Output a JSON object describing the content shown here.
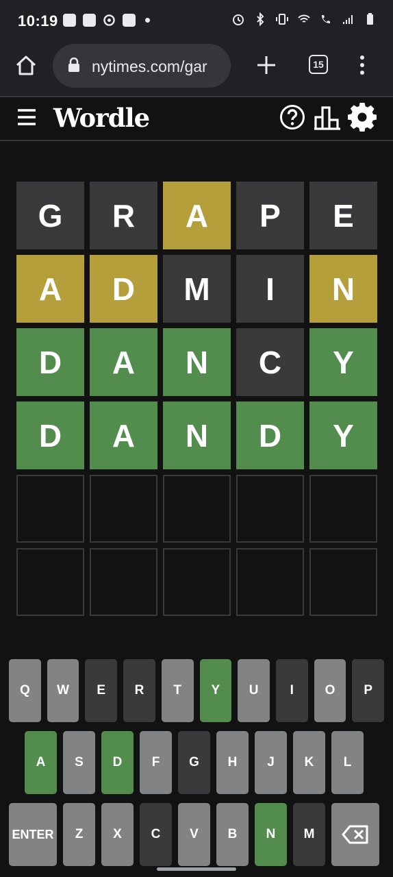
{
  "status_bar": {
    "time": "10:19",
    "left_icons": [
      "notification-icon",
      "news-icon",
      "swirl-icon",
      "news-icon",
      "dot-icon"
    ],
    "right_icons": [
      "alarm-icon",
      "bluetooth-icon",
      "vibrate-icon",
      "wifi-icon",
      "wifi-call-icon",
      "signal-icon",
      "battery-icon"
    ]
  },
  "browser": {
    "url": "nytimes.com/gar",
    "tab_count": "15"
  },
  "header": {
    "title": "Wordle"
  },
  "colors": {
    "correct": "#538d4e",
    "present": "#b59f3b",
    "absent": "#3a3a3c",
    "unused_key": "#818384",
    "background": "#121213"
  },
  "board": [
    [
      {
        "letter": "G",
        "state": "absent"
      },
      {
        "letter": "R",
        "state": "absent"
      },
      {
        "letter": "A",
        "state": "present"
      },
      {
        "letter": "P",
        "state": "absent"
      },
      {
        "letter": "E",
        "state": "absent"
      }
    ],
    [
      {
        "letter": "A",
        "state": "present"
      },
      {
        "letter": "D",
        "state": "present"
      },
      {
        "letter": "M",
        "state": "absent"
      },
      {
        "letter": "I",
        "state": "absent"
      },
      {
        "letter": "N",
        "state": "present"
      }
    ],
    [
      {
        "letter": "D",
        "state": "correct"
      },
      {
        "letter": "A",
        "state": "correct"
      },
      {
        "letter": "N",
        "state": "correct"
      },
      {
        "letter": "C",
        "state": "absent"
      },
      {
        "letter": "Y",
        "state": "correct"
      }
    ],
    [
      {
        "letter": "D",
        "state": "correct"
      },
      {
        "letter": "A",
        "state": "correct"
      },
      {
        "letter": "N",
        "state": "correct"
      },
      {
        "letter": "D",
        "state": "correct"
      },
      {
        "letter": "Y",
        "state": "correct"
      }
    ],
    [
      {
        "letter": "",
        "state": "empty"
      },
      {
        "letter": "",
        "state": "empty"
      },
      {
        "letter": "",
        "state": "empty"
      },
      {
        "letter": "",
        "state": "empty"
      },
      {
        "letter": "",
        "state": "empty"
      }
    ],
    [
      {
        "letter": "",
        "state": "empty"
      },
      {
        "letter": "",
        "state": "empty"
      },
      {
        "letter": "",
        "state": "empty"
      },
      {
        "letter": "",
        "state": "empty"
      },
      {
        "letter": "",
        "state": "empty"
      }
    ]
  ],
  "keyboard": [
    [
      {
        "label": "Q",
        "state": "unused"
      },
      {
        "label": "W",
        "state": "unused"
      },
      {
        "label": "E",
        "state": "absent"
      },
      {
        "label": "R",
        "state": "absent"
      },
      {
        "label": "T",
        "state": "unused"
      },
      {
        "label": "Y",
        "state": "correct"
      },
      {
        "label": "U",
        "state": "unused"
      },
      {
        "label": "I",
        "state": "absent"
      },
      {
        "label": "O",
        "state": "unused"
      },
      {
        "label": "P",
        "state": "absent"
      }
    ],
    [
      {
        "label": "A",
        "state": "correct"
      },
      {
        "label": "S",
        "state": "unused"
      },
      {
        "label": "D",
        "state": "correct"
      },
      {
        "label": "F",
        "state": "unused"
      },
      {
        "label": "G",
        "state": "absent"
      },
      {
        "label": "H",
        "state": "unused"
      },
      {
        "label": "J",
        "state": "unused"
      },
      {
        "label": "K",
        "state": "unused"
      },
      {
        "label": "L",
        "state": "unused"
      }
    ],
    [
      {
        "label": "ENTER",
        "state": "unused",
        "wide": true
      },
      {
        "label": "Z",
        "state": "unused"
      },
      {
        "label": "X",
        "state": "unused"
      },
      {
        "label": "C",
        "state": "absent"
      },
      {
        "label": "V",
        "state": "unused"
      },
      {
        "label": "B",
        "state": "unused"
      },
      {
        "label": "N",
        "state": "correct"
      },
      {
        "label": "M",
        "state": "absent"
      },
      {
        "label": "",
        "state": "unused",
        "wide": true,
        "icon": "backspace-icon"
      }
    ]
  ]
}
